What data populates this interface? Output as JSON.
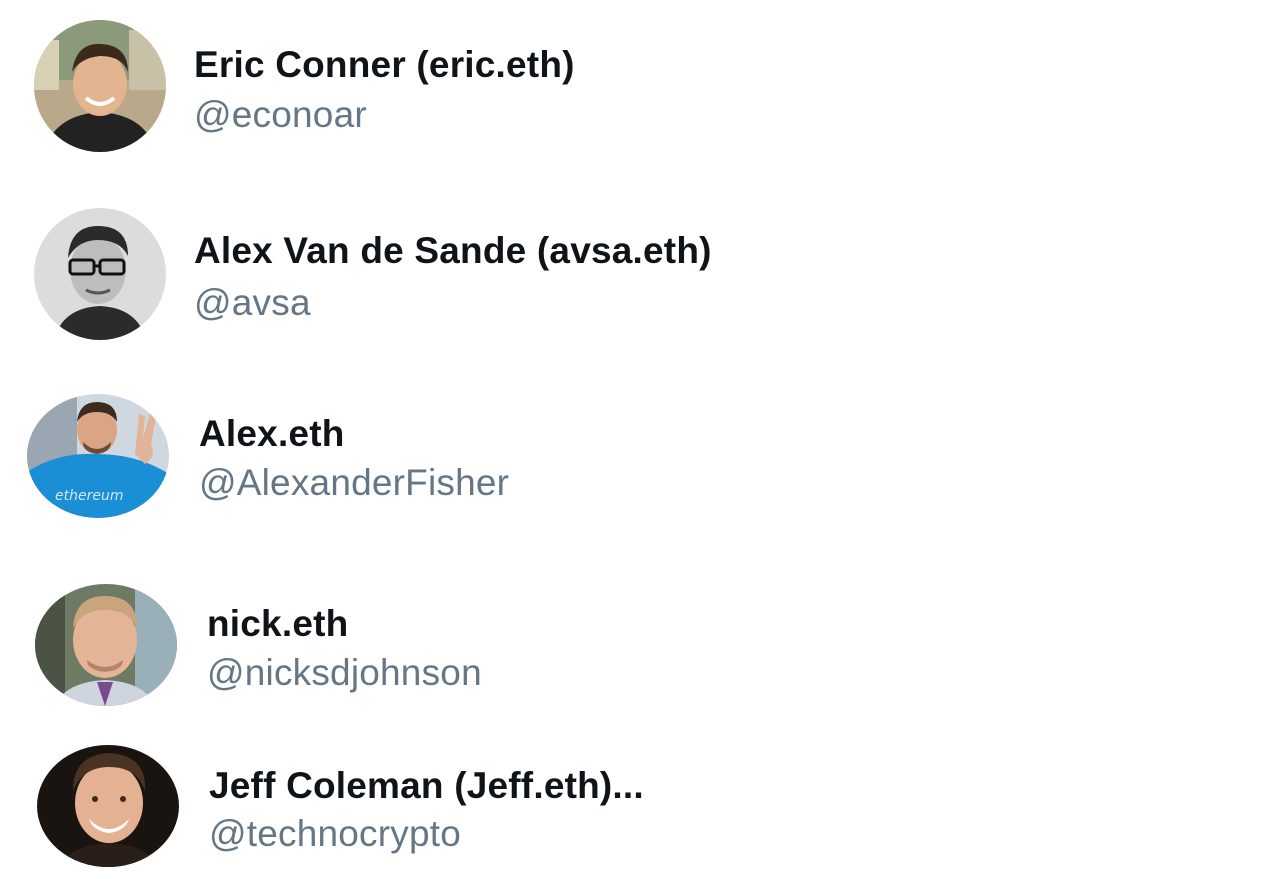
{
  "accounts": [
    {
      "name": "Eric Conner (eric.eth)",
      "handle": "@econoar",
      "avatar_icon": "user-photo-avatar"
    },
    {
      "name": "Alex Van de Sande (avsa.eth)",
      "handle": "@avsa",
      "avatar_icon": "user-photo-avatar"
    },
    {
      "name": "Alex.eth",
      "handle": "@AlexanderFisher",
      "avatar_icon": "user-photo-avatar",
      "avatar_text": "ethereum"
    },
    {
      "name": "nick.eth",
      "handle": "@nicksdjohnson",
      "avatar_icon": "user-photo-avatar"
    },
    {
      "name": "Jeff Coleman (Jeff.eth)...",
      "handle": "@technocrypto",
      "avatar_icon": "user-photo-avatar"
    }
  ],
  "colors": {
    "name_text": "#0f1419",
    "handle_text": "#657786",
    "background": "#ffffff"
  }
}
